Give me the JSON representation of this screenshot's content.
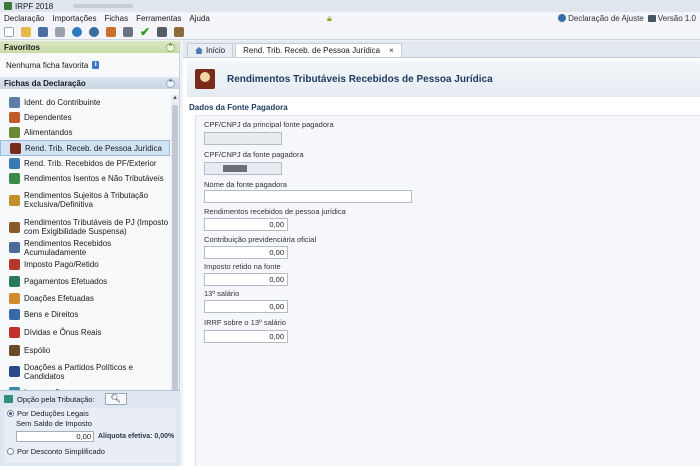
{
  "window": {
    "title": "IRPF 2018"
  },
  "menu": {
    "items": [
      "Declaração",
      "Importações",
      "Fichas",
      "Ferramentas",
      "Ajuda"
    ],
    "declaracao_ajuste": "Declaração de Ajuste",
    "versao": "Versão 1.0"
  },
  "sidebar": {
    "favoritos": {
      "title": "Favoritos",
      "empty_text": "Nenhuma ficha favorita"
    },
    "fichas": {
      "title": "Fichas da Declaração",
      "items": [
        {
          "label": "Ident. do Contribuinte",
          "icon": "id-card-icon",
          "color": "#5b7fa6"
        },
        {
          "label": "Dependentes",
          "icon": "dependents-icon",
          "color": "#c25b2a"
        },
        {
          "label": "Alimentandos",
          "icon": "alimentandos-icon",
          "color": "#6a8a3a"
        },
        {
          "label": "Rend. Trib. Receb. de Pessoa Jurídica",
          "icon": "company-income-icon",
          "color": "#7a2a1a"
        },
        {
          "label": "Rend. Trib. Recebidos de PF/Exterior",
          "icon": "person-income-icon",
          "color": "#3a7ab5"
        },
        {
          "label": "Rendimentos Isentos e Não Tributáveis",
          "icon": "exempt-income-icon",
          "color": "#3a8a4a"
        },
        {
          "label": "Rendimentos Sujeitos à Tributação Exclusiva/Definitiva",
          "icon": "exclusive-tax-icon",
          "color": "#c2902a"
        },
        {
          "label": "Rendimentos Tributáveis de PJ (Imposto com Exigibilidade Suspensa)",
          "icon": "suspended-tax-icon",
          "color": "#8a5a2a"
        },
        {
          "label": "Rendimentos Recebidos Acumuladamente",
          "icon": "accumulated-income-icon",
          "color": "#4a6a9a"
        },
        {
          "label": "Imposto Pago/Retido",
          "icon": "tax-paid-icon",
          "color": "#b5362a"
        },
        {
          "label": "Pagamentos Efetuados",
          "icon": "payments-icon",
          "color": "#2a7a5a"
        },
        {
          "label": "Doações Efetuadas",
          "icon": "donations-icon",
          "color": "#d08a2a"
        },
        {
          "label": "Bens e Direitos",
          "icon": "assets-icon",
          "color": "#3a6aa5"
        },
        {
          "label": "Dívidas e Ônus Reais",
          "icon": "debts-icon",
          "color": "#c2302a"
        },
        {
          "label": "Espólio",
          "icon": "estate-icon",
          "color": "#6a4a2a"
        },
        {
          "label": "Doações a Partidos Políticos e Candidatos",
          "icon": "political-donations-icon",
          "color": "#2a4a8a"
        },
        {
          "label": "Importações",
          "icon": "imports-icon",
          "color": "#3a8aaa"
        }
      ]
    },
    "opcao": {
      "title": "Opção pela Tributação:",
      "deducoes": "Por Deduções Legais",
      "sem_saldo": "Sem Saldo de Imposto",
      "valor": "0,00",
      "aliquota": "Alíquota efetiva: 0,00%",
      "simplificado": "Por Desconto Simplificado"
    }
  },
  "tabs": [
    {
      "label": "Início"
    },
    {
      "label": "Rend. Trib. Receb. de Pessoa Jurídica"
    }
  ],
  "page": {
    "title": "Rendimentos Tributáveis Recebidos de Pessoa Jurídica",
    "section": "Dados da Fonte Pagadora",
    "fields": [
      {
        "label": "CPF/CNPJ da principal fonte pagadora",
        "value": ""
      },
      {
        "label": "CPF/CNPJ da fonte pagadora",
        "value": ""
      },
      {
        "label": "Nome da fonte pagadora",
        "value": ""
      },
      {
        "label": "Rendimentos recebidos de pessoa jurídica",
        "value": "0,00"
      },
      {
        "label": "Contribuição previdenciária oficial",
        "value": "0,00"
      },
      {
        "label": "Imposto retido na fonte",
        "value": "0,00"
      },
      {
        "label": "13º salário",
        "value": "0,00"
      },
      {
        "label": "IRRF sobre o 13º salário",
        "value": "0,00"
      }
    ]
  }
}
